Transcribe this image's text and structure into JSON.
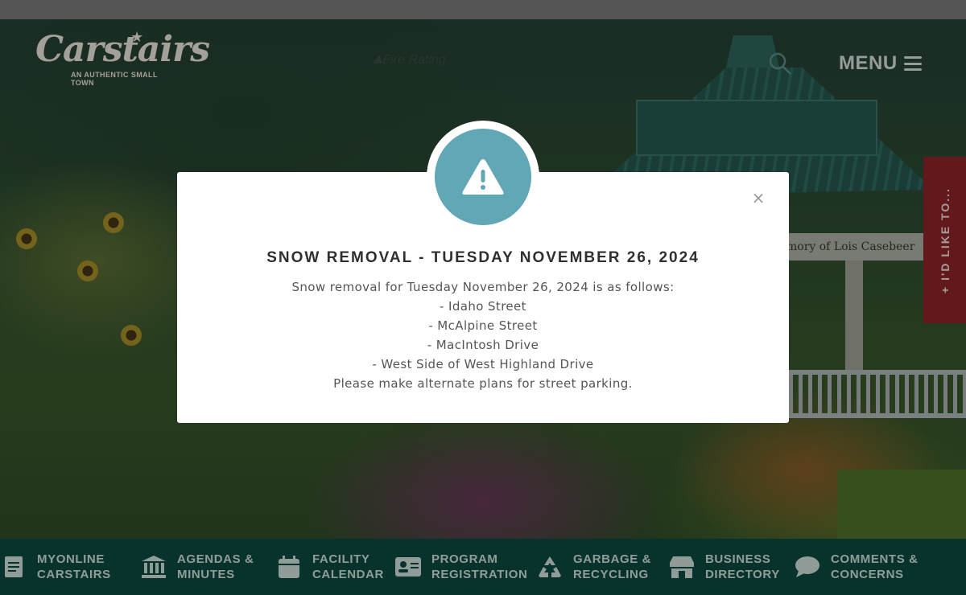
{
  "header": {
    "logo_text": "Carstairs",
    "logo_tagline": "AN AUTHENTIC SMALL TOWN",
    "fire_rating_label": "Fire Rating",
    "menu_label": "MENU"
  },
  "side_tab": {
    "label": "+ I'D LIKE TO..."
  },
  "hero": {
    "banner_text": "mory of Lois Casebeer"
  },
  "modal": {
    "title": "SNOW REMOVAL - TUESDAY NOVEMBER 26, 2024",
    "intro": "Snow removal for Tuesday November 26, 2024 is as follows:",
    "items": [
      "- Idaho Street",
      "- McAlpine Street",
      "- MacIntosh Drive",
      "- West Side of West Highland Drive"
    ],
    "footer": "Please make alternate plans for street parking.",
    "close_label": "×",
    "accent_color": "#62a7b5"
  },
  "quicklinks": [
    {
      "label": "MYONLINE\nCARSTAIRS",
      "icon": "document-icon"
    },
    {
      "label": "AGENDAS &\nMINUTES",
      "icon": "bank-icon"
    },
    {
      "label": "FACILITY\nCALENDAR",
      "icon": "calendar-icon"
    },
    {
      "label": "PROGRAM\nREGISTRATION",
      "icon": "id-card-icon"
    },
    {
      "label": "GARBAGE &\nRECYCLING",
      "icon": "recycle-icon"
    },
    {
      "label": "BUSINESS\nDIRECTORY",
      "icon": "storefront-icon"
    },
    {
      "label": "COMMENTS &\nCONCERNS",
      "icon": "speech-bubble-icon"
    }
  ],
  "colors": {
    "quicklinks_bg": "#0c4a41",
    "side_tab_bg": "#8e2327",
    "modal_bg": "#ffffff"
  }
}
